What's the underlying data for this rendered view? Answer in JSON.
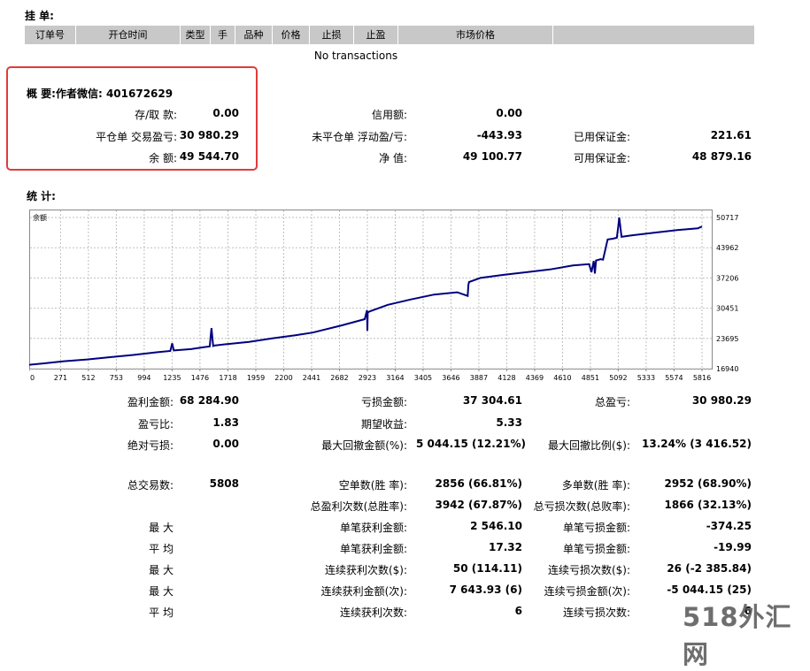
{
  "orders": {
    "title": "挂 单:",
    "columns": [
      "订单号",
      "开仓时间",
      "类型",
      "手",
      "品种",
      "价格",
      "止损",
      "止盈",
      "市场价格",
      ""
    ],
    "empty_text": "No transactions"
  },
  "summary": {
    "title": "概 要:作者微信: 401672629",
    "rows": [
      [
        {
          "label": "存/取 款:",
          "value": "0.00"
        },
        {
          "label": "信用额:",
          "value": "0.00"
        },
        {
          "label": "",
          "value": ""
        }
      ],
      [
        {
          "label": "平仓单 交易盈亏:",
          "value": "30 980.29"
        },
        {
          "label": "未平仓单 浮动盈/亏:",
          "value": "-443.93"
        },
        {
          "label": "已用保证金:",
          "value": "221.61"
        }
      ],
      [
        {
          "label": "余 额:",
          "value": "49 544.70"
        },
        {
          "label": "净 值:",
          "value": "49 100.77"
        },
        {
          "label": "可用保证金:",
          "value": "48 879.16"
        }
      ]
    ]
  },
  "stats": {
    "title": "统 计:",
    "rows": [
      [
        {
          "l": "盈利金额:",
          "v": "68 284.90"
        },
        {
          "l": "亏损金额:",
          "v": "37 304.61"
        },
        {
          "l": "总盈亏:",
          "v": "30 980.29"
        }
      ],
      [
        {
          "l": "盈亏比:",
          "v": "1.83"
        },
        {
          "l": "期望收益:",
          "v": "5.33"
        },
        {
          "l": "",
          "v": ""
        }
      ],
      [
        {
          "l": "绝对亏损:",
          "v": "0.00"
        },
        {
          "l": "最大回撤金额(%):",
          "v": "5 044.15 (12.21%)"
        },
        {
          "l": "最大回撤比例($):",
          "v": "13.24% (3 416.52)"
        }
      ],
      [
        {
          "l": "总交易数:",
          "v": "5808"
        },
        {
          "l": "空单数(胜 率):",
          "v": "2856 (66.81%)"
        },
        {
          "l": "多单数(胜 率):",
          "v": "2952 (68.90%)"
        }
      ],
      [
        {
          "l": "",
          "v": ""
        },
        {
          "l": "总盈利次数(总胜率):",
          "v": "3942 (67.87%)"
        },
        {
          "l": "总亏损次数(总败率):",
          "v": "1866 (32.13%)"
        }
      ],
      [
        {
          "l": "最 大",
          "v": ""
        },
        {
          "l": "单笔获利金额:",
          "v": "2 546.10"
        },
        {
          "l": "单笔亏损金额:",
          "v": "-374.25"
        }
      ],
      [
        {
          "l": "平 均",
          "v": ""
        },
        {
          "l": "单笔获利金额:",
          "v": "17.32"
        },
        {
          "l": "单笔亏损金额:",
          "v": "-19.99"
        }
      ],
      [
        {
          "l": "最 大",
          "v": ""
        },
        {
          "l": "连续获利次数($):",
          "v": "50 (114.11)"
        },
        {
          "l": "连续亏损次数($):",
          "v": "26 (-2 385.84)"
        }
      ],
      [
        {
          "l": "最 大",
          "v": ""
        },
        {
          "l": "连续获利金额(次):",
          "v": "7 643.93 (6)"
        },
        {
          "l": "连续亏损金额(次):",
          "v": "-5 044.15 (25)"
        }
      ],
      [
        {
          "l": "平 均",
          "v": ""
        },
        {
          "l": "连续获利次数:",
          "v": "6"
        },
        {
          "l": "连续亏损次数:",
          "v": "6"
        }
      ]
    ]
  },
  "chart_data": {
    "type": "line",
    "title": "余额",
    "x_ticks": [
      0,
      271,
      512,
      753,
      994,
      1235,
      1476,
      1718,
      1959,
      2200,
      2441,
      2682,
      2923,
      3164,
      3405,
      3646,
      3887,
      4128,
      4369,
      4610,
      4851,
      5092,
      5333,
      5574,
      5816
    ],
    "y_ticks": [
      16940,
      23695,
      30451,
      37206,
      43962,
      50717
    ],
    "xlim": [
      0,
      5900
    ],
    "ylim": [
      16940,
      52500
    ],
    "grid": true,
    "line_color": "#00007f",
    "series": [
      {
        "x": [
          0,
          120,
          300,
          500,
          700,
          900,
          1100,
          1220,
          1236,
          1250,
          1300,
          1400,
          1500,
          1560,
          1576,
          1590,
          1600,
          1700,
          1900,
          2100,
          2300,
          2450,
          2700,
          2900,
          2920,
          2923,
          2926,
          2950,
          3100,
          3300,
          3500,
          3700,
          3790,
          3796,
          3802,
          3900,
          4100,
          4300,
          4500,
          4700,
          4840,
          4860,
          4880,
          4890,
          4900,
          4940,
          4960,
          5000,
          5050,
          5080,
          5092,
          5100,
          5120,
          5200,
          5400,
          5600,
          5780,
          5816
        ],
        "y": [
          17800,
          18100,
          18600,
          19000,
          19500,
          20000,
          20600,
          20900,
          22600,
          21000,
          21100,
          21300,
          21700,
          21900,
          26000,
          22000,
          22100,
          22400,
          22900,
          23700,
          24400,
          25000,
          26600,
          28000,
          30000,
          25400,
          29500,
          29800,
          31200,
          32400,
          33500,
          34000,
          33200,
          35600,
          36300,
          37200,
          37900,
          38500,
          39100,
          40000,
          40300,
          38500,
          41000,
          38200,
          41100,
          41400,
          41300,
          45800,
          46000,
          46200,
          48700,
          50700,
          46400,
          46700,
          47300,
          47900,
          48300,
          48700
        ]
      }
    ]
  },
  "watermark": "518外汇网"
}
